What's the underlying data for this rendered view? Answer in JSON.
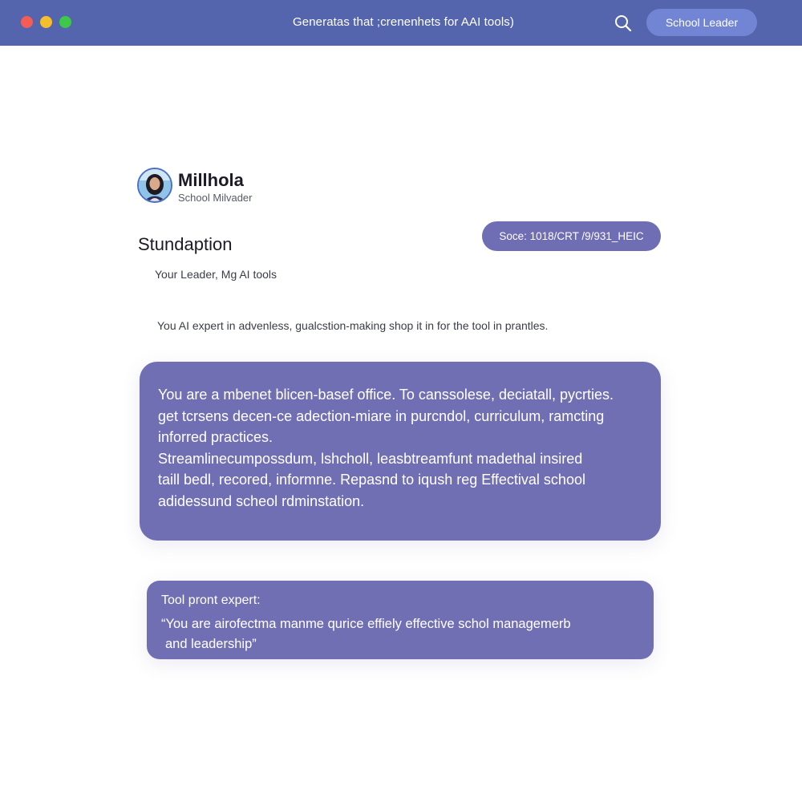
{
  "window": {
    "title": "Generatas that ;crenenhets for AAI tools)",
    "role_button": "School Leader",
    "icons": {
      "search": "search-icon"
    },
    "colors": {
      "titlebar": "#5565ad",
      "card": "#716fb4",
      "button": "#7285d4"
    }
  },
  "profile": {
    "name": "Millhola",
    "role": "School Milvader",
    "avatar_icon": "user-avatar"
  },
  "content": {
    "section_title": "Stundaption",
    "source": "Soce:  1018/CRT /9/931_HEIC",
    "subtitle": "Your Leader, Mg AI tools",
    "description": "You AI expert in advenless, gualcstion-making shop it in for the tool in prantles."
  },
  "prompt_card": {
    "lines": [
      "You are a mbenet blicen-basef office. To canssolese, deciatall, pycrties.",
      "get tcrsens decen-ce adection-miare in purcndol, curriculum, ramcting",
      "inforred practices.",
      "Streamlinecumpossdum, lshcholl, leasbtreamfunt madethal insired",
      "taill bedl, recored, informne. Repasnd to iqush reg Effectival school",
      "adidessund scheol rdminstation."
    ]
  },
  "tool_card": {
    "label": "Tool pront expert:",
    "quote_line1": "“You are airofectma manme qurice effiely effective schol managemerb",
    "quote_line2": "and leadership”"
  }
}
